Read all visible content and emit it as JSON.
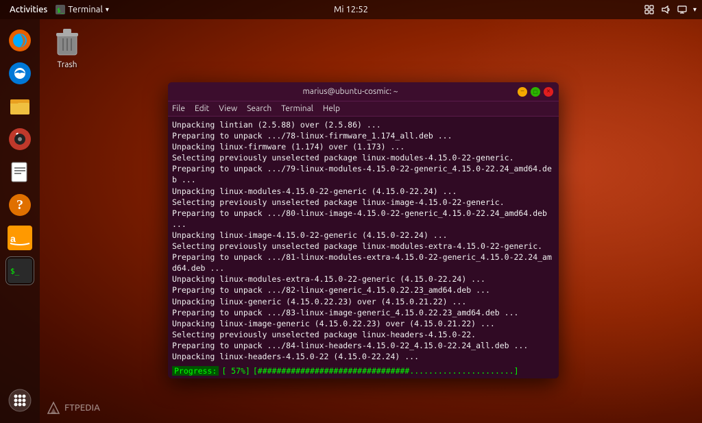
{
  "topbar": {
    "activities": "Activities",
    "app_name": "Terminal",
    "time": "Mi 12:52",
    "dropdown_arrow": "▾"
  },
  "desktop": {
    "trash_label": "Trash"
  },
  "terminal": {
    "title": "marius@ubuntu-cosmic: ~",
    "menu_items": [
      "File",
      "Edit",
      "View",
      "Search",
      "Terminal",
      "Help"
    ],
    "lines": [
      "Unpacking lintian (2.5.88) over (2.5.86) ...",
      "Preparing to unpack .../78-linux-firmware_1.174_all.deb ...",
      "Unpacking linux-firmware (1.174) over (1.173) ...",
      "Selecting previously unselected package linux-modules-4.15.0-22-generic.",
      "Preparing to unpack .../79-linux-modules-4.15.0-22-generic_4.15.0-22.24_amd64.de",
      "b ...",
      "Unpacking linux-modules-4.15.0-22-generic (4.15.0-22.24) ...",
      "Selecting previously unselected package linux-image-4.15.0-22-generic.",
      "Preparing to unpack .../80-linux-image-4.15.0-22-generic_4.15.0-22.24_amd64.deb",
      "...",
      "Unpacking linux-image-4.15.0-22-generic (4.15.0-22.24) ...",
      "Selecting previously unselected package linux-modules-extra-4.15.0-22-generic.",
      "Preparing to unpack .../81-linux-modules-extra-4.15.0-22-generic_4.15.0-22.24_am",
      "d64.deb ...",
      "Unpacking linux-modules-extra-4.15.0-22-generic (4.15.0-22.24) ...",
      "Preparing to unpack .../82-linux-generic_4.15.0.22.23_amd64.deb ...",
      "Unpacking linux-generic (4.15.0.22.23) over (4.15.0.21.22) ...",
      "Preparing to unpack .../83-linux-image-generic_4.15.0.22.23_amd64.deb ...",
      "Unpacking linux-image-generic (4.15.0.22.23) over (4.15.0.21.22) ...",
      "Selecting previously unselected package linux-headers-4.15.0-22.",
      "Preparing to unpack .../84-linux-headers-4.15.0-22_4.15.0-22.24_all.deb ...",
      "Unpacking linux-headers-4.15.0-22 (4.15.0-22.24) ..."
    ],
    "progress_label": "Progress:",
    "progress_percent": "[ 57%]",
    "progress_bar": "[################################......................]",
    "min_btn": "−",
    "max_btn": "□",
    "close_btn": "×"
  },
  "dock": {
    "icons": [
      {
        "name": "firefox",
        "label": "Firefox"
      },
      {
        "name": "thunderbird",
        "label": "Thunderbird"
      },
      {
        "name": "files",
        "label": "Files"
      },
      {
        "name": "music",
        "label": "Rhythmbox"
      },
      {
        "name": "document",
        "label": "LibreOffice"
      },
      {
        "name": "help",
        "label": "Help"
      },
      {
        "name": "amazon",
        "label": "Amazon"
      },
      {
        "name": "terminal",
        "label": "Terminal"
      },
      {
        "name": "appgrid",
        "label": "Show Applications"
      }
    ]
  },
  "ftpedia": {
    "label": "FTPEDIA"
  }
}
